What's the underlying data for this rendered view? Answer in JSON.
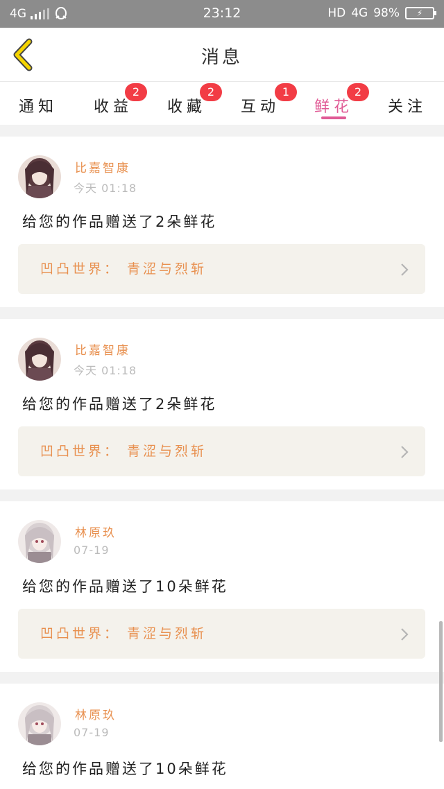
{
  "status": {
    "network_left": "4G",
    "time": "23:12",
    "hd": "HD",
    "network_right": "4G",
    "battery": "98%"
  },
  "header": {
    "title": "消息",
    "back_label": ""
  },
  "tabs": [
    {
      "label": "通知",
      "badge": ""
    },
    {
      "label": "收益",
      "badge": "2"
    },
    {
      "label": "收藏",
      "badge": "2"
    },
    {
      "label": "互动",
      "badge": "1"
    },
    {
      "label": "鲜花",
      "badge": "2",
      "active": true
    },
    {
      "label": "关注",
      "badge": ""
    }
  ],
  "messages": [
    {
      "user": "比嘉智康",
      "time": "今天 01:18",
      "text": "给您的作品赠送了2朵鲜花",
      "work": "凹凸世界： 青涩与烈斩"
    },
    {
      "user": "比嘉智康",
      "time": "今天 01:18",
      "text": "给您的作品赠送了2朵鲜花",
      "work": "凹凸世界： 青涩与烈斩"
    },
    {
      "user": "林原玖",
      "time": "07-19",
      "text": "给您的作品赠送了10朵鲜花",
      "work": "凹凸世界： 青涩与烈斩"
    },
    {
      "user": "林原玖",
      "time": "07-19",
      "text": "给您的作品赠送了10朵鲜花",
      "work": ""
    }
  ],
  "colors": {
    "accent": "#e05a95",
    "name": "#e8904f",
    "badge": "#f23c45",
    "back": "#f5d400"
  }
}
